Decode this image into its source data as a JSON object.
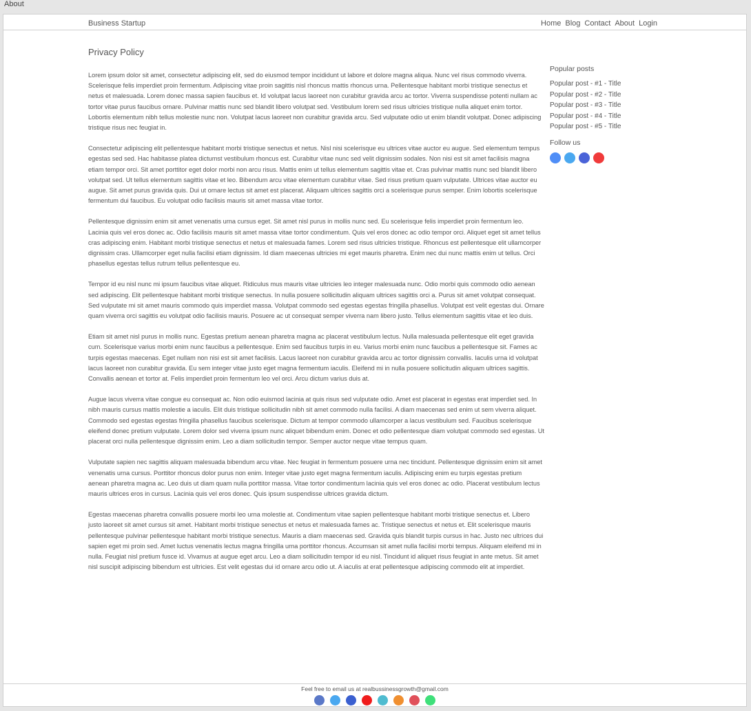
{
  "window": {
    "title": "About"
  },
  "header": {
    "brand": "Business Startup",
    "nav": [
      "Home",
      "Blog",
      "Contact",
      "About",
      "Login"
    ]
  },
  "main": {
    "title": "Privacy Policy",
    "paragraphs": [
      "Lorem ipsum dolor sit amet, consectetur adipiscing elit, sed do eiusmod tempor incididunt ut labore et dolore magna aliqua. Nunc vel risus commodo viverra. Scelerisque felis imperdiet proin fermentum. Adipiscing vitae proin sagittis nisl rhoncus mattis rhoncus urna. Pellentesque habitant morbi tristique senectus et netus et malesuada. Lorem donec massa sapien faucibus et. Id volutpat lacus laoreet non curabitur gravida arcu ac tortor. Viverra suspendisse potenti nullam ac tortor vitae purus faucibus ornare. Pulvinar mattis nunc sed blandit libero volutpat sed. Vestibulum lorem sed risus ultricies tristique nulla aliquet enim tortor. Lobortis elementum nibh tellus molestie nunc non. Volutpat lacus laoreet non curabitur gravida arcu. Sed vulputate odio ut enim blandit volutpat. Donec adipiscing tristique risus nec feugiat in.",
      "Consectetur adipiscing elit pellentesque habitant morbi tristique senectus et netus. Nisl nisi scelerisque eu ultrices vitae auctor eu augue. Sed elementum tempus egestas sed sed. Hac habitasse platea dictumst vestibulum rhoncus est. Curabitur vitae nunc sed velit dignissim sodales. Non nisi est sit amet facilisis magna etiam tempor orci. Sit amet porttitor eget dolor morbi non arcu risus. Mattis enim ut tellus elementum sagittis vitae et. Cras pulvinar mattis nunc sed blandit libero volutpat sed. Ut tellus elementum sagittis vitae et leo. Bibendum arcu vitae elementum curabitur vitae. Sed risus pretium quam vulputate. Ultrices vitae auctor eu augue. Sit amet purus gravida quis. Dui ut ornare lectus sit amet est placerat. Aliquam ultrices sagittis orci a scelerisque purus semper. Enim lobortis scelerisque fermentum dui faucibus. Eu volutpat odio facilisis mauris sit amet massa vitae tortor.",
      "Pellentesque dignissim enim sit amet venenatis urna cursus eget. Sit amet nisl purus in mollis nunc sed. Eu scelerisque felis imperdiet proin fermentum leo. Lacinia quis vel eros donec ac. Odio facilisis mauris sit amet massa vitae tortor condimentum. Quis vel eros donec ac odio tempor orci. Aliquet eget sit amet tellus cras adipiscing enim. Habitant morbi tristique senectus et netus et malesuada fames. Lorem sed risus ultricies tristique. Rhoncus est pellentesque elit ullamcorper dignissim cras. Ullamcorper eget nulla facilisi etiam dignissim. Id diam maecenas ultricies mi eget mauris pharetra. Enim nec dui nunc mattis enim ut tellus. Orci phasellus egestas tellus rutrum tellus pellentesque eu.",
      "Tempor id eu nisl nunc mi ipsum faucibus vitae aliquet. Ridiculus mus mauris vitae ultricies leo integer malesuada nunc. Odio morbi quis commodo odio aenean sed adipiscing. Elit pellentesque habitant morbi tristique senectus. In nulla posuere sollicitudin aliquam ultrices sagittis orci a. Purus sit amet volutpat consequat. Sed vulputate mi sit amet mauris commodo quis imperdiet massa. Volutpat commodo sed egestas egestas fringilla phasellus. Volutpat est velit egestas dui. Ornare quam viverra orci sagittis eu volutpat odio facilisis mauris. Posuere ac ut consequat semper viverra nam libero justo. Tellus elementum sagittis vitae et leo duis.",
      "Etiam sit amet nisl purus in mollis nunc. Egestas pretium aenean pharetra magna ac placerat vestibulum lectus. Nulla malesuada pellentesque elit eget gravida cum. Scelerisque varius morbi enim nunc faucibus a pellentesque. Enim sed faucibus turpis in eu. Varius morbi enim nunc faucibus a pellentesque sit. Fames ac turpis egestas maecenas. Eget nullam non nisi est sit amet facilisis. Lacus laoreet non curabitur gravida arcu ac tortor dignissim convallis. Iaculis urna id volutpat lacus laoreet non curabitur gravida. Eu sem integer vitae justo eget magna fermentum iaculis. Eleifend mi in nulla posuere sollicitudin aliquam ultrices sagittis. Convallis aenean et tortor at. Felis imperdiet proin fermentum leo vel orci. Arcu dictum varius duis at.",
      "Augue lacus viverra vitae congue eu consequat ac. Non odio euismod lacinia at quis risus sed vulputate odio. Amet est placerat in egestas erat imperdiet sed. In nibh mauris cursus mattis molestie a iaculis. Elit duis tristique sollicitudin nibh sit amet commodo nulla facilisi. A diam maecenas sed enim ut sem viverra aliquet. Commodo sed egestas egestas fringilla phasellus faucibus scelerisque. Dictum at tempor commodo ullamcorper a lacus vestibulum sed. Faucibus scelerisque eleifend donec pretium vulputate. Lorem dolor sed viverra ipsum nunc aliquet bibendum enim. Donec et odio pellentesque diam volutpat commodo sed egestas. Ut placerat orci nulla pellentesque dignissim enim. Leo a diam sollicitudin tempor. Semper auctor neque vitae tempus quam.",
      "Vulputate sapien nec sagittis aliquam malesuada bibendum arcu vitae. Nec feugiat in fermentum posuere urna nec tincidunt. Pellentesque dignissim enim sit amet venenatis urna cursus. Porttitor rhoncus dolor purus non enim. Integer vitae justo eget magna fermentum iaculis. Adipiscing enim eu turpis egestas pretium aenean pharetra magna ac. Leo duis ut diam quam nulla porttitor massa. Vitae tortor condimentum lacinia quis vel eros donec ac odio. Placerat vestibulum lectus mauris ultrices eros in cursus. Lacinia quis vel eros donec. Quis ipsum suspendisse ultrices gravida dictum.",
      "Egestas maecenas pharetra convallis posuere morbi leo urna molestie at. Condimentum vitae sapien pellentesque habitant morbi tristique senectus et. Libero justo laoreet sit amet cursus sit amet. Habitant morbi tristique senectus et netus et malesuada fames ac. Tristique senectus et netus et. Elit scelerisque mauris pellentesque pulvinar pellentesque habitant morbi tristique senectus. Mauris a diam maecenas sed. Gravida quis blandit turpis cursus in hac. Justo nec ultrices dui sapien eget mi proin sed. Amet luctus venenatis lectus magna fringilla urna porttitor rhoncus. Accumsan sit amet nulla facilisi morbi tempus. Aliquam eleifend mi in nulla. Feugiat nisl pretium fusce id. Vivamus at augue eget arcu. Leo a diam sollicitudin tempor id eu nisl. Tincidunt id aliquet risus feugiat in ante metus. Sit amet nisl suscipit adipiscing bibendum est ultricies. Est velit egestas dui id ornare arcu odio ut. A iaculis at erat pellentesque adipiscing commodo elit at imperdiet."
    ]
  },
  "sidebar": {
    "popular_heading": "Popular posts",
    "posts": [
      "Popular post - #1 - Title",
      "Popular post - #2 - Title",
      "Popular post - #3 - Title",
      "Popular post - #4 - Title",
      "Popular post - #5 - Title"
    ],
    "follow_heading": "Follow us",
    "follow_icons": [
      {
        "name": "facebook-icon",
        "color": "#4f8ef7"
      },
      {
        "name": "twitter-icon",
        "color": "#4aa8f0"
      },
      {
        "name": "linkedin-icon",
        "color": "#4a63d8"
      },
      {
        "name": "youtube-icon",
        "color": "#f03a3a"
      }
    ]
  },
  "footer": {
    "text": "Feel free to email us at realbussinessgrowth@gmail.com",
    "icons": [
      {
        "name": "facebook-icon",
        "color": "#5a78c8"
      },
      {
        "name": "twitter-icon",
        "color": "#4aa8f0"
      },
      {
        "name": "linkedin-icon",
        "color": "#3a5fd0"
      },
      {
        "name": "youtube-icon",
        "color": "#f01c1c"
      },
      {
        "name": "vimeo-icon",
        "color": "#4fbcd0"
      },
      {
        "name": "rss-icon",
        "color": "#f08f30"
      },
      {
        "name": "pinterest-icon",
        "color": "#e0505a"
      },
      {
        "name": "whatsapp-icon",
        "color": "#3fe07a"
      }
    ]
  }
}
